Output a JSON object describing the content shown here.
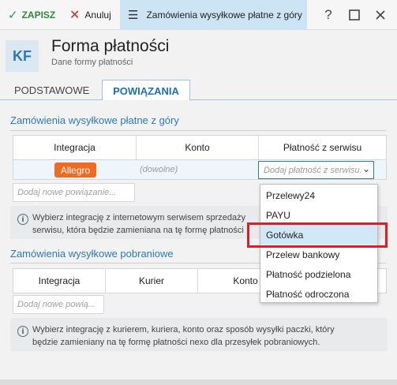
{
  "toolbar": {
    "save_label": "ZAPISZ",
    "cancel_label": "Anuluj",
    "window_title": "Zamówienia wysyłkowe płatne z góry",
    "help_symbol": "?"
  },
  "header": {
    "logo": "KF",
    "title": "Forma płatności",
    "subtitle": "Dane formy płatności"
  },
  "tabs": [
    {
      "label": "PODSTAWOWE",
      "active": false
    },
    {
      "label": "POWIĄZANIA",
      "active": true
    }
  ],
  "section1": {
    "title": "Zamówienia wysyłkowe płatne z góry",
    "columns": [
      "Integracja",
      "Konto",
      "Płatność z serwisu"
    ],
    "row": {
      "integration": "Allegro",
      "account_placeholder": "(dowolne)",
      "payment_placeholder": "Dodaj płatność z serwisu..."
    },
    "add_placeholder": "Dodaj nowe powiązanie...",
    "info": [
      "Wybierz integrację z internetowym serwisem sprzedaży",
      "serwisu, która będzie zamieniana na tę formę płatności"
    ]
  },
  "dropdown": {
    "options": [
      "Przelewy24",
      "PAYU",
      "Gotówka",
      "Przelew bankowy",
      "Płatność podzielona",
      "Płatność odroczona"
    ],
    "highlighted": "Gotówka"
  },
  "section2": {
    "title": "Zamówienia wysyłkowe pobraniowe",
    "columns": [
      "Integracja",
      "Kurier",
      "Konto"
    ],
    "add_placeholder": "Dodaj nowe powią...",
    "info": [
      "Wybierz integrację z kurierem, kuriera, konto oraz sposób wysyłki paczki, który",
      "będzie zamieniany na tę formę płatności nexo dla przesyłek pobraniowych."
    ]
  },
  "colors": {
    "accent": "#2b7ab8",
    "allegro": "#f26a1f",
    "highlight_box": "#e01d24",
    "save": "#2e8b3a",
    "cancel": "#d12b2b"
  }
}
